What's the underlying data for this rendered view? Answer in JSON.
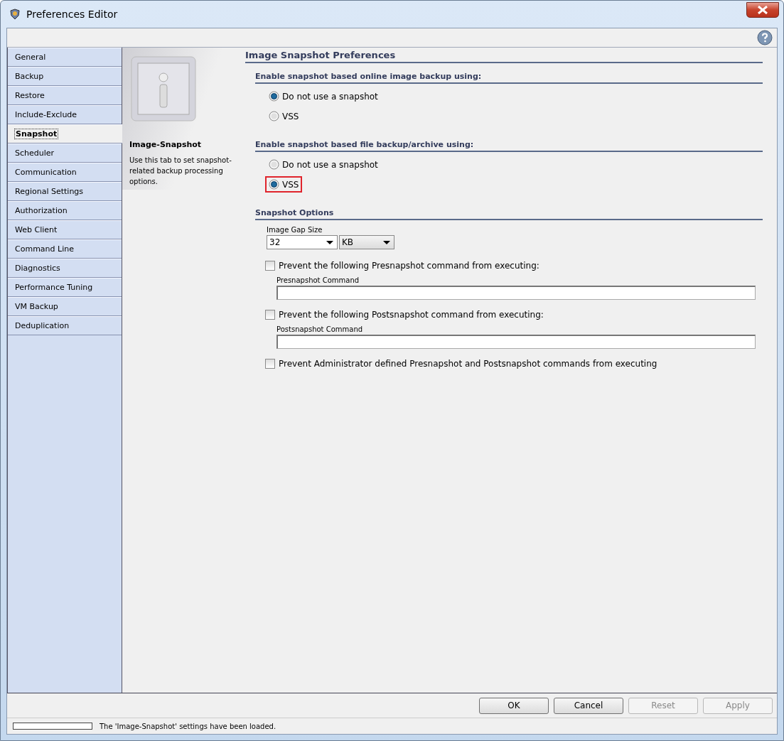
{
  "window": {
    "title": "Preferences Editor"
  },
  "tabs": [
    {
      "label": "General",
      "selected": false
    },
    {
      "label": "Backup",
      "selected": false
    },
    {
      "label": "Restore",
      "selected": false
    },
    {
      "label": "Include-Exclude",
      "selected": false
    },
    {
      "label": "Snapshot",
      "selected": true
    },
    {
      "label": "Scheduler",
      "selected": false
    },
    {
      "label": "Communication",
      "selected": false
    },
    {
      "label": "Regional Settings",
      "selected": false
    },
    {
      "label": "Authorization",
      "selected": false
    },
    {
      "label": "Web Client",
      "selected": false
    },
    {
      "label": "Command Line",
      "selected": false
    },
    {
      "label": "Diagnostics",
      "selected": false
    },
    {
      "label": "Performance Tuning",
      "selected": false
    },
    {
      "label": "VM Backup",
      "selected": false
    },
    {
      "label": "Deduplication",
      "selected": false
    }
  ],
  "info_panel": {
    "title": "Image-Snapshot",
    "description": "Use this tab to set snapshot-related backup processing options."
  },
  "page_title": "Image Snapshot Preferences",
  "groups": [
    {
      "heading": "Enable snapshot based online image backup using:",
      "options": [
        {
          "label": "Do not use a snapshot",
          "selected": true,
          "highlighted": false
        },
        {
          "label": "VSS",
          "selected": false,
          "highlighted": false
        }
      ]
    },
    {
      "heading": "Enable snapshot based file backup/archive using:",
      "options": [
        {
          "label": "Do not use a snapshot",
          "selected": false,
          "highlighted": false
        },
        {
          "label": "VSS",
          "selected": true,
          "highlighted": true
        }
      ]
    }
  ],
  "snapshot_options": {
    "heading": "Snapshot Options",
    "gap_size": {
      "label": "Image Gap Size",
      "value": "32",
      "unit": "KB"
    },
    "items": [
      {
        "kind": "checkbox",
        "label": "Prevent the following Presnapshot command from executing:",
        "checked": false
      },
      {
        "kind": "field",
        "label": "Presnapshot Command"
      },
      {
        "kind": "checkbox",
        "label": "Prevent the following Postsnapshot command from executing:",
        "checked": false
      },
      {
        "kind": "field",
        "label": "Postsnapshot Command"
      },
      {
        "kind": "checkbox",
        "label": "Prevent Administrator defined Presnapshot and Postsnapshot commands from executing",
        "checked": false
      }
    ]
  },
  "buttons": [
    {
      "label": "OK",
      "disabled": false
    },
    {
      "label": "Cancel",
      "disabled": false
    },
    {
      "label": "Reset",
      "disabled": true
    },
    {
      "label": "Apply",
      "disabled": true
    }
  ],
  "status_bar": {
    "progress": {
      "level": 0
    },
    "message": "The 'Image-Snapshot' settings have been loaded."
  }
}
